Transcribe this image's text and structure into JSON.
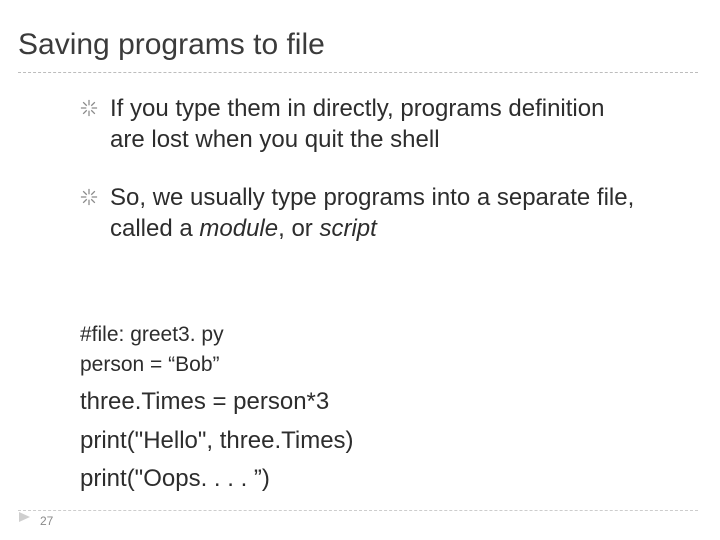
{
  "title": "Saving programs to file",
  "bullets": [
    {
      "plain": "If you type them in directly, programs definition are lost when you quit the shell"
    },
    {
      "prefix": "So, we usually type programs into a separate file, called a ",
      "em1": "module",
      "mid": ", or ",
      "em2": "script"
    }
  ],
  "code": {
    "l1": "#file: greet3. py",
    "l2": "person = “Bob”",
    "l3": "three.Times = person*3",
    "l4": "print(\"Hello\", three.Times)",
    "l5": "print(\"Oops. . . . ”)"
  },
  "page_number": "27"
}
